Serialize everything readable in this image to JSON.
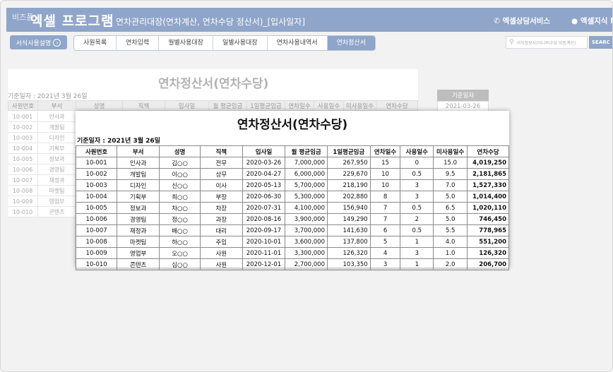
{
  "header": {
    "brand_small": "비즈폼",
    "brand_main": "엑셀 프로그램",
    "title": "연차관리대장(연차계산, 연차수당 정산서)_[입사일자]",
    "link1": "엑셀상담서비스",
    "link2": "엑셀지식 IN"
  },
  "toolbar": {
    "guide_label": "서식사용설명",
    "tabs": [
      "사원목록",
      "연차입력",
      "월별사용대장",
      "일별사용대장",
      "연차사용내역서",
      "연차정산서"
    ],
    "search_placeholder": "서식정보사(이나비수당 자동계산)",
    "search_button": "SEARC"
  },
  "sheet": {
    "title": "연차정산서(연차수당)",
    "date_label": "기준일자 : 2021년 3월 26일",
    "headers": [
      "사원번호",
      "부서",
      "성명",
      "직책",
      "입사일",
      "월 평균임금",
      "1일평균임금",
      "연차일수",
      "사용일수",
      "미사용일수",
      "연차수당"
    ],
    "ids": [
      "10-001",
      "10-002",
      "10-003",
      "10-004",
      "10-005",
      "10-006",
      "10-007",
      "10-008",
      "10-009",
      "10-010"
    ],
    "depts": [
      "인사과",
      "개발팀",
      "디자인",
      "기획부",
      "정보과",
      "경영팀",
      "재정과",
      "마켓팀",
      "영업부",
      "콘텐츠"
    ]
  },
  "base_date": {
    "label": "기준일자",
    "value": "2021-03-26"
  },
  "popup": {
    "title": "연차정산서(연차수당)",
    "date_label": "기준일자 : 2021년 3월 26일",
    "columns": [
      "사원번호",
      "부서",
      "성명",
      "직책",
      "입사일",
      "월 평균임금",
      "1일평균임금",
      "연차일수",
      "사용일수",
      "미사용일수",
      "연차수당"
    ],
    "rows": [
      [
        "10-001",
        "인사과",
        "김○○",
        "전무",
        "2020-03-26",
        "7,000,000",
        "267,950",
        "15",
        "0",
        "15.0",
        "4,019,250"
      ],
      [
        "10-002",
        "개발팀",
        "이○○",
        "상무",
        "2020-04-27",
        "6,000,000",
        "229,670",
        "10",
        "0.5",
        "9.5",
        "2,181,865"
      ],
      [
        "10-003",
        "디자인",
        "신○○",
        "이사",
        "2020-05-13",
        "5,700,000",
        "218,190",
        "10",
        "3",
        "7.0",
        "1,527,330"
      ],
      [
        "10-004",
        "기획부",
        "최○○",
        "부장",
        "2020-06-30",
        "5,300,000",
        "202,880",
        "8",
        "3",
        "5.0",
        "1,014,400"
      ],
      [
        "10-005",
        "정보과",
        "차○○",
        "차장",
        "2020-07-31",
        "4,100,000",
        "156,940",
        "7",
        "0.5",
        "6.5",
        "1,020,110"
      ],
      [
        "10-006",
        "경영팀",
        "정○○",
        "과장",
        "2020-08-16",
        "3,900,000",
        "149,290",
        "7",
        "2",
        "5.0",
        "746,450"
      ],
      [
        "10-007",
        "재정과",
        "배○○",
        "대리",
        "2020-09-17",
        "3,700,000",
        "141,630",
        "6",
        "0.5",
        "5.5",
        "778,965"
      ],
      [
        "10-008",
        "마켓팀",
        "하○○",
        "주임",
        "2020-10-01",
        "3,600,000",
        "137,800",
        "5",
        "1",
        "4.0",
        "551,200"
      ],
      [
        "10-009",
        "영업부",
        "오○○",
        "사원",
        "2020-11-01",
        "3,300,000",
        "126,320",
        "4",
        "3",
        "1.0",
        "126,320"
      ],
      [
        "10-010",
        "콘텐츠",
        "심○○",
        "사원",
        "2020-12-01",
        "2,700,000",
        "103,350",
        "3",
        "1",
        "2.0",
        "206,700"
      ]
    ]
  }
}
